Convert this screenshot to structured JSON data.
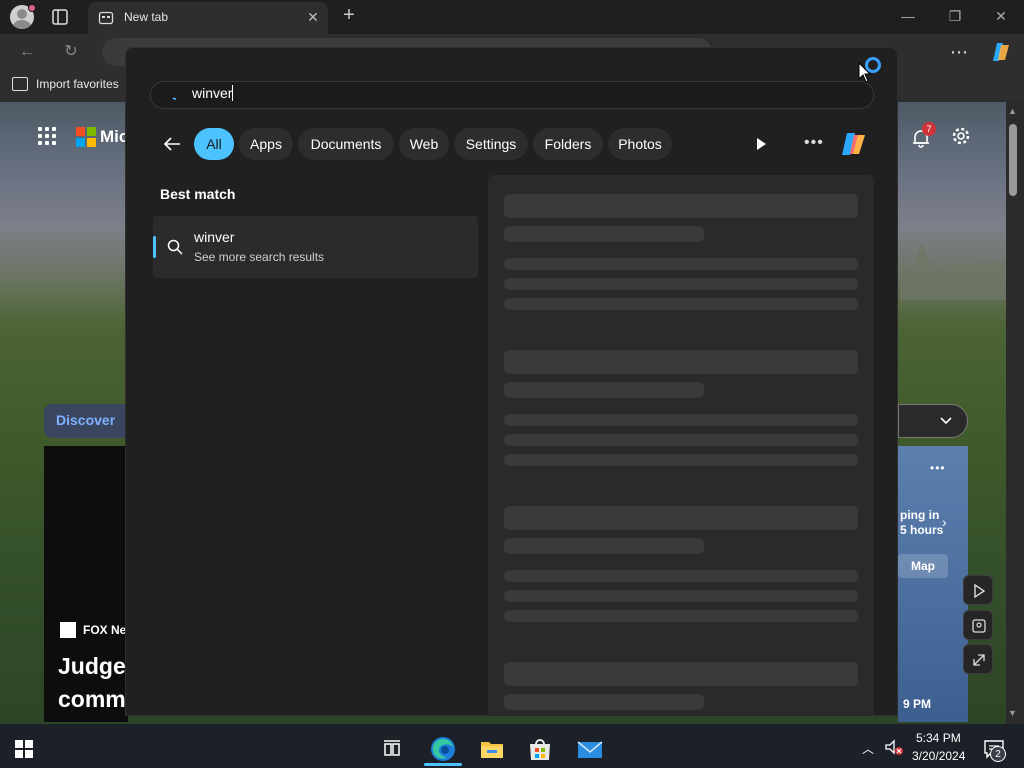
{
  "browser": {
    "tab_title": "New tab",
    "favorites_import_label": "Import favorites"
  },
  "new_tab_page": {
    "brand_text": "Mic",
    "notification_count": "7",
    "discover_label": "Discover",
    "feed_source": "FOX Ne",
    "feed_headline_line1": "Judge",
    "feed_headline_line2": "comm",
    "weather_line1": "ping in",
    "weather_line2": "5 hours",
    "map_label": "Map",
    "weather_time": "9 PM"
  },
  "search": {
    "query": "winver",
    "filters": [
      {
        "label": "All",
        "active": true
      },
      {
        "label": "Apps",
        "active": false
      },
      {
        "label": "Documents",
        "active": false
      },
      {
        "label": "Web",
        "active": false
      },
      {
        "label": "Settings",
        "active": false
      },
      {
        "label": "Folders",
        "active": false
      },
      {
        "label": "Photos",
        "active": false
      }
    ],
    "best_match_label": "Best match",
    "best_match": {
      "title": "winver",
      "subtitle": "See more search results"
    }
  },
  "taskbar": {
    "time": "5:34 PM",
    "date": "3/20/2024",
    "notification_count": "2"
  },
  "colors": {
    "accent": "#4cc2ff",
    "overlay_bg": "#202020",
    "preview_bg": "#2a2a2a",
    "skeleton": "#3a3a3a"
  },
  "icons": [
    "profile-icon",
    "tabs-icon",
    "new-tab-icon",
    "back-icon",
    "refresh-icon",
    "copilot-icon",
    "search-icon",
    "play-icon",
    "more-icon",
    "bell-icon",
    "gear-icon",
    "windows-start-icon",
    "edge-icon",
    "file-explorer-icon",
    "store-icon",
    "mail-icon",
    "volume-muted-icon",
    "notification-icon"
  ]
}
